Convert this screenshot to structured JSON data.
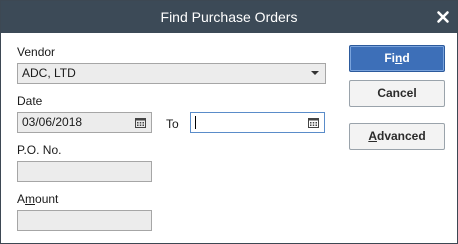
{
  "window": {
    "title": "Find Purchase Orders",
    "close_icon": "close-icon"
  },
  "form": {
    "vendor_label": "Vendor",
    "vendor_value": "ADC, LTD",
    "date_label": "Date",
    "date_from_value": "03/06/2018",
    "to_label": "To",
    "date_to_value": "",
    "po_label": "P.O. No.",
    "po_value": "",
    "amount_label_pre": "A",
    "amount_label_ul": "m",
    "amount_label_post": "ount",
    "amount_value": ""
  },
  "buttons": {
    "find_pre": "Fi",
    "find_ul": "n",
    "find_post": "d",
    "cancel": "Cancel",
    "advanced_ul": "A",
    "advanced_post": "dvanced"
  }
}
